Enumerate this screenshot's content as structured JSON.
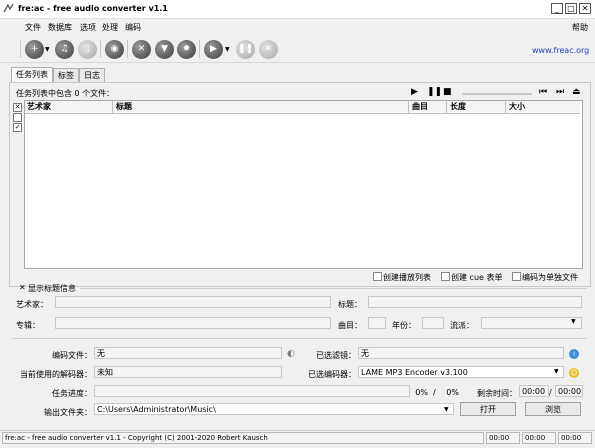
{
  "window": {
    "title": "fre:ac - free audio converter v1.1",
    "btn_min": "_",
    "btn_max": "□",
    "btn_close": "✕"
  },
  "menu": {
    "items": [
      "文件",
      "数据库",
      "选项",
      "处理",
      "编码"
    ],
    "help": "帮助"
  },
  "toolbar": {
    "link": "www.freac.org"
  },
  "tabs": [
    "任务列表",
    "标签",
    "日志"
  ],
  "joblist": {
    "status": "任务列表中包含 0 个文件：",
    "columns": {
      "artist": "艺术家",
      "title": "标题",
      "track": "曲目",
      "length": "长度",
      "size": "大小"
    },
    "check_marks": [
      "✕",
      "",
      "✓"
    ]
  },
  "options": {
    "playlist": "创建播放列表",
    "cue": "创建 cue 表单",
    "single": "编码为单独文件"
  },
  "title_info": {
    "toggle": "显示标题信息",
    "artist_label": "艺术家：",
    "title_label": "标题：",
    "album_label": "专辑：",
    "track_label": "曲目：",
    "year_label": "年份：",
    "genre_label": "流派："
  },
  "encoding": {
    "file_label": "编码文件：",
    "file_value": "无",
    "filter_label": "已选滤镜：",
    "filter_value": "无",
    "decoder_label": "当前使用的解码器：",
    "decoder_value": "未知",
    "encoder_label": "已选编码器：",
    "encoder_value": "LAME MP3 Encoder v3.100",
    "progress_label": "任务进度：",
    "pct1": "0%",
    "sep": "/",
    "pct2": "0%",
    "remaining_label": "剩余时间：",
    "time1": "00:00",
    "time2": "00:00",
    "output_label": "输出文件夹：",
    "output_value": "C:\\Users\\Administrator\\Music\\",
    "open_button": "打开",
    "browse_button": "浏览"
  },
  "statusbar": {
    "text": "fre:ac - free audio converter v1.1 - Copyright (C) 2001-2020 Robert Kausch",
    "time1": "00:00",
    "time2": "00:00",
    "time3": "00:00"
  },
  "colors": {
    "link": "#2040c0"
  }
}
